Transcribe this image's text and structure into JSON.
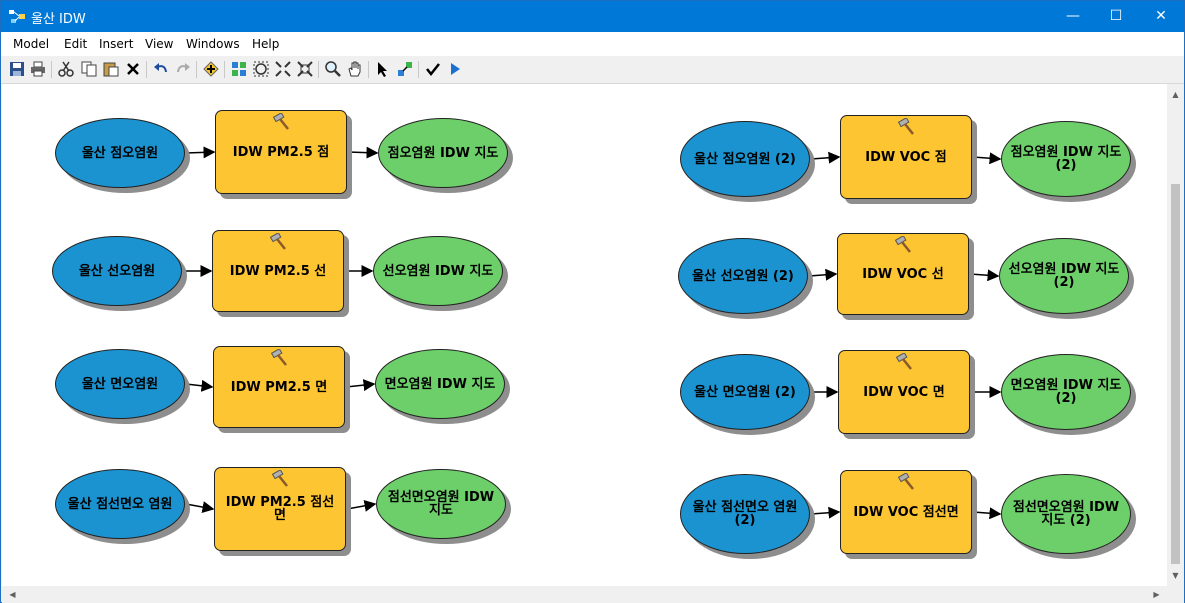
{
  "window": {
    "title": "울산 IDW",
    "controls": {
      "minimize": "—",
      "maximize": "☐",
      "close": "✕"
    }
  },
  "menu": [
    "Model",
    "Edit",
    "Insert",
    "View",
    "Windows",
    "Help"
  ],
  "toolbar": {
    "icons": [
      "save-icon",
      "print-icon",
      "cut-icon",
      "copy-icon",
      "paste-icon",
      "delete-icon",
      "undo-icon",
      "redo-icon",
      "add-data-icon",
      "auto-layout-icon",
      "full-extent-icon",
      "zoom-in-fixed-icon",
      "zoom-out-fixed-icon",
      "zoom-icon",
      "pan-icon",
      "select-icon",
      "connect-icon",
      "validate-icon",
      "run-icon"
    ]
  },
  "diagram": {
    "colors": {
      "input": "#1a93d0",
      "tool": "#fdc532",
      "output": "#6dcf6a"
    },
    "rows": [
      {
        "input": "울산 점오염원",
        "tool": "IDW PM2.5 점",
        "output": "점오염원 IDW 지도"
      },
      {
        "input": "울산 선오염원",
        "tool": "IDW PM2.5 선",
        "output": "선오염원 IDW 지도"
      },
      {
        "input": "울산 면오염원",
        "tool": "IDW PM2.5 면",
        "output": "면오염원 IDW 지도"
      },
      {
        "input": "울산 점선면오 염원",
        "tool": "IDW PM2.5 점선 면",
        "output": "점선면오염원 IDW 지도"
      },
      {
        "input": "울산 점오염원 (2)",
        "tool": "IDW VOC 점",
        "output": "점오염원 IDW 지도 (2)"
      },
      {
        "input": "울산 선오염원 (2)",
        "tool": "IDW VOC 선",
        "output": "선오염원 IDW 지도 (2)"
      },
      {
        "input": "울산 면오염원 (2)",
        "tool": "IDW VOC 면",
        "output": "면오염원 IDW 지도 (2)"
      },
      {
        "input": "울산 점선면오 염원 (2)",
        "tool": "IDW VOC 점선면",
        "output": "점선면오염원 IDW 지도 (2)"
      }
    ]
  }
}
